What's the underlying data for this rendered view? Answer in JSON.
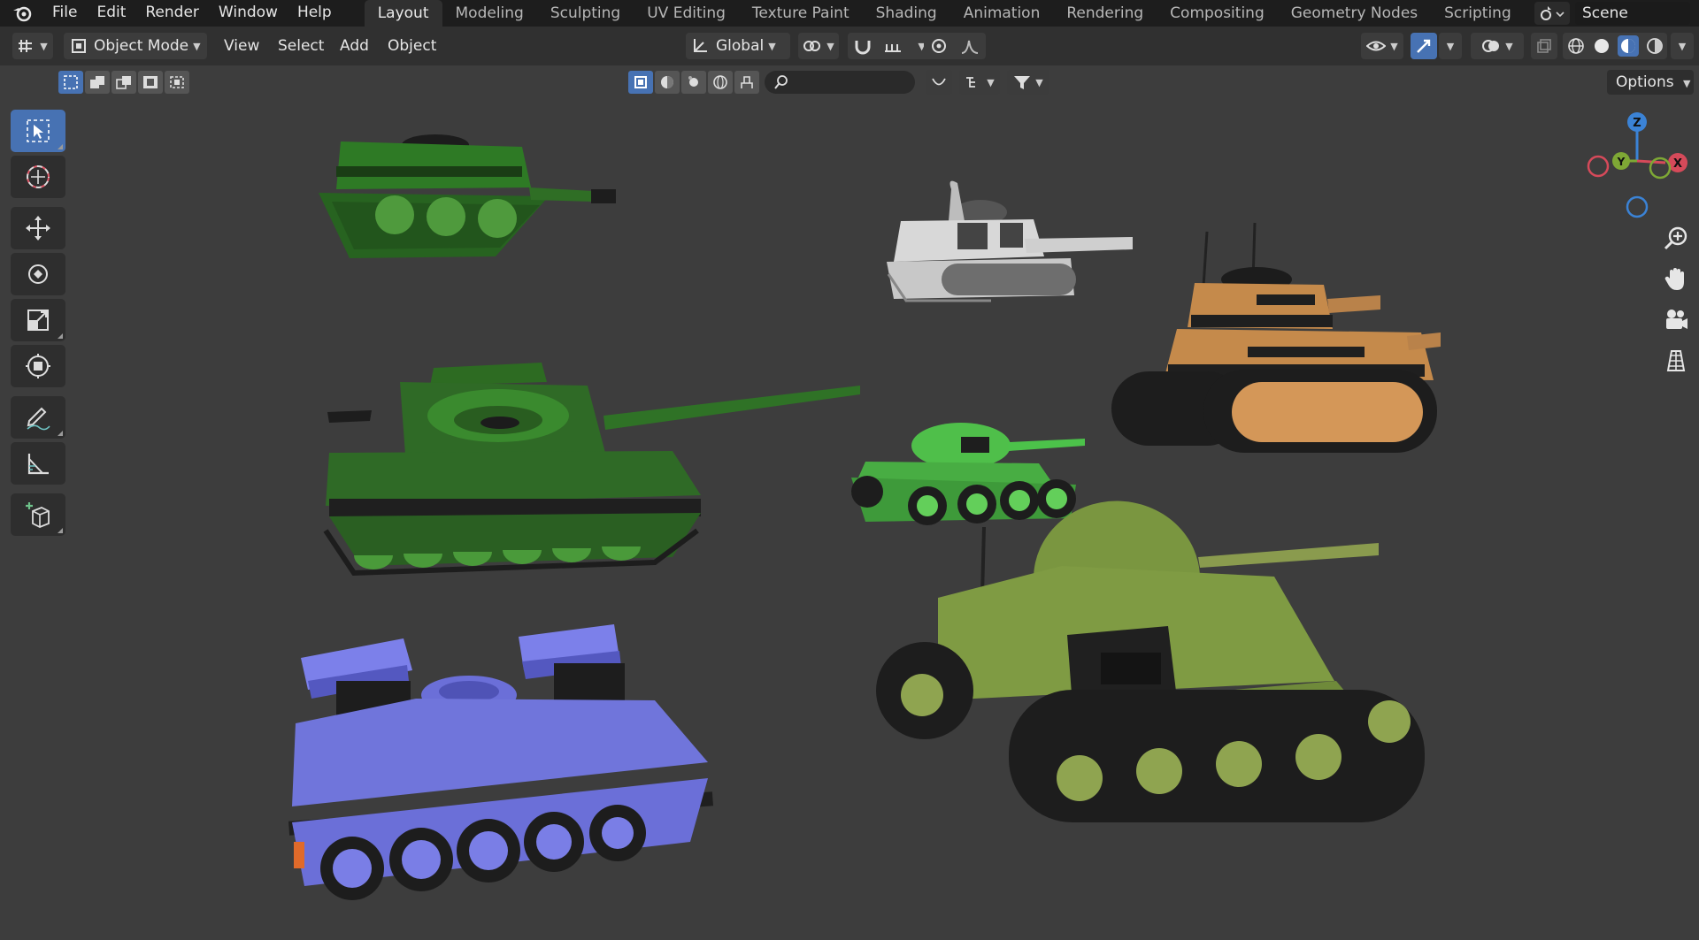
{
  "app": {
    "name": "Blender"
  },
  "menubar": {
    "items": [
      {
        "label": "File"
      },
      {
        "label": "Edit"
      },
      {
        "label": "Render"
      },
      {
        "label": "Window"
      },
      {
        "label": "Help"
      }
    ]
  },
  "workspaces": {
    "tabs": [
      {
        "label": "Layout",
        "active": true
      },
      {
        "label": "Modeling"
      },
      {
        "label": "Sculpting"
      },
      {
        "label": "UV Editing"
      },
      {
        "label": "Texture Paint"
      },
      {
        "label": "Shading"
      },
      {
        "label": "Animation"
      },
      {
        "label": "Rendering"
      },
      {
        "label": "Compositing"
      },
      {
        "label": "Geometry Nodes"
      },
      {
        "label": "Scripting"
      }
    ],
    "add_label": "+"
  },
  "scene": {
    "name": "Scene"
  },
  "header": {
    "mode": "Object Mode",
    "view": "View",
    "select": "Select",
    "add": "Add",
    "object": "Object",
    "orientation": "Global"
  },
  "tool_settings": {
    "search_placeholder": "",
    "options_label": "Options"
  },
  "gizmo": {
    "x_label": "X",
    "y_label": "Y",
    "z_label": "Z"
  },
  "colors": {
    "accent": "#4772b3",
    "topbar": "#1d1d1d",
    "header": "#303030",
    "viewport": "#3d3d3d",
    "axis_x": "#d64a5a",
    "axis_y": "#7ea835",
    "axis_z": "#3b83d6"
  },
  "viewport_objects": [
    {
      "name": "dark-green-tank",
      "color": "#2e6b24"
    },
    {
      "name": "white-tank",
      "color": "#d6d6d6"
    },
    {
      "name": "orange-tank",
      "color": "#c8894a"
    },
    {
      "name": "large-green-tank",
      "color": "#2f6a26"
    },
    {
      "name": "light-green-tank",
      "color": "#4fbf4a"
    },
    {
      "name": "olive-tank",
      "color": "#7f9b43"
    },
    {
      "name": "blue-rocket-tank",
      "color": "#6b6fd8"
    }
  ]
}
